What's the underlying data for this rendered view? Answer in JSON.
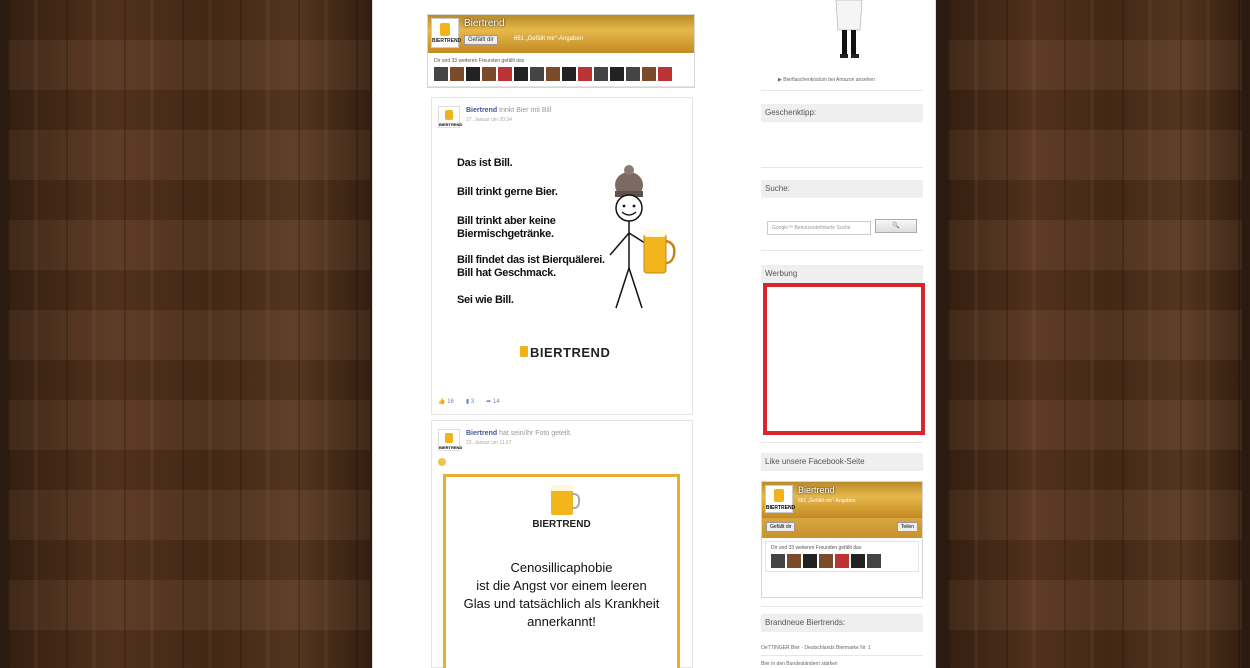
{
  "fb_widget_top": {
    "page_name": "Biertrend",
    "logo_text": "BIERTREND",
    "like_button": "Gefällt dir",
    "like_count": "661 „Gefällt mir“-Angaben",
    "friends_text": "Dir und 33 weiteren Freunden gefällt das"
  },
  "post1": {
    "author": "Biertrend",
    "action": "trinkt Bier mit Bill",
    "time": "27. Januar um 20:34",
    "bill_lines": [
      "Das ist Bill.",
      "Bill trinkt gerne Bier.",
      "Bill trinkt aber keine",
      "Biermischgetränke.",
      "Bill findet das ist Bierquälerei.",
      "Bill hat Geschmack.",
      "Sei wie Bill."
    ],
    "brand": "BIERTREND",
    "likes": "16",
    "comments": "3",
    "shares": "14"
  },
  "post2": {
    "author": "Biertrend",
    "action": "hat sein/ihr Foto geteilt.",
    "time": "23. Januar um 11:37",
    "card_brand": "BIERTREND",
    "card_lines": [
      "Cenosillicaphobie",
      "ist die Angst vor einem leeren",
      "Glas und tatsächlich als Krankheit",
      "annerkannt!"
    ]
  },
  "sidebar": {
    "amazon_link": "▶ Bierflaschenkostüm bei Amazon ansehen",
    "gift_heading": "Geschenktipp:",
    "search_heading": "Suche:",
    "search_placeholder": "Google™ Benutzerdefinierte Suche",
    "search_button": "🔍",
    "ad_heading": "Werbung",
    "facebook_heading": "Like unsere Facebook-Seite",
    "fb2_name": "Biertrend",
    "fb2_count": "661 „Gefällt mir“-Angaben",
    "fb2_logo": "BIERTREND",
    "fb2_like": "Gefällt dir",
    "fb2_share": "Teilen",
    "fb2_friends": "Dir und 33 weiteren Freunden gefällt das",
    "new_heading": "Brandneue Biertrends:",
    "new_items": [
      "OeTTINGER Bier - Deutschlands Biermarke Nr. 1",
      "Bier in den Bundesländern stärken"
    ]
  },
  "colors": {
    "ad_border": "#d9262b",
    "card_border": "#e5b230",
    "fb_blue": "#3b5998"
  }
}
